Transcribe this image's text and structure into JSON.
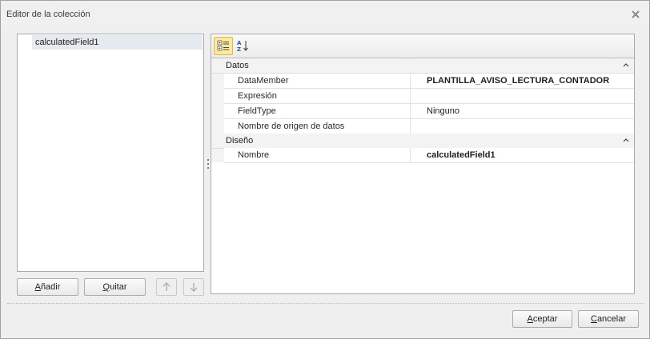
{
  "window": {
    "title": "Editor de la colección"
  },
  "list": {
    "items": [
      "calculatedField1"
    ]
  },
  "buttons": {
    "add": {
      "key": "A",
      "rest": "ñadir"
    },
    "remove": {
      "key": "Q",
      "rest": "uitar"
    },
    "ok": {
      "key": "A",
      "rest": "ceptar"
    },
    "cancel": {
      "key": "C",
      "rest": "ancelar"
    }
  },
  "toolbar": {
    "categorized": "categorized-icon",
    "alphabetical": "sort-alphabetical-icon"
  },
  "properties": {
    "datos": {
      "label": "Datos",
      "rows": [
        {
          "name": "DataMember",
          "value": "PLANTILLA_AVISO_LECTURA_CONTADOR"
        },
        {
          "name": "Expresión",
          "value": ""
        },
        {
          "name": "FieldType",
          "value": "Ninguno"
        },
        {
          "name": "Nombre de origen de datos",
          "value": ""
        }
      ]
    },
    "diseno": {
      "label": "Diseño",
      "rows": [
        {
          "name": "Nombre",
          "value": "calculatedField1"
        }
      ]
    }
  },
  "colors": {
    "accent": "#fde99b",
    "selection": "#e5eaf1",
    "border": "#a7abb0"
  }
}
